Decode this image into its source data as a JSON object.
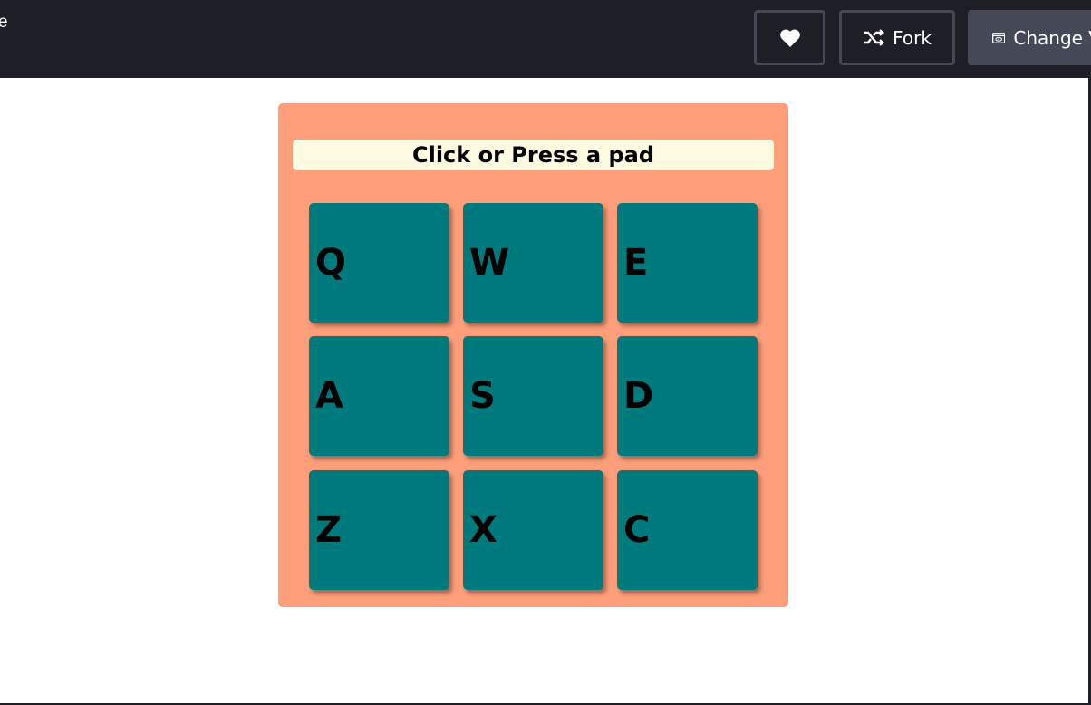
{
  "topbar": {
    "title_fragment": "e",
    "heart_icon": "heart-icon",
    "fork_label": "Fork",
    "fork_icon": "fork-icon",
    "change_label": "Change V",
    "change_icon": "view-icon"
  },
  "drum_machine": {
    "display_text": "Click or Press a pad",
    "pads": [
      "Q",
      "W",
      "E",
      "A",
      "S",
      "D",
      "Z",
      "X",
      "C"
    ]
  },
  "colors": {
    "panel": "#ff9e7a",
    "pad": "#007b7d",
    "display": "#fffbe0",
    "topbar": "#1e1f26"
  }
}
